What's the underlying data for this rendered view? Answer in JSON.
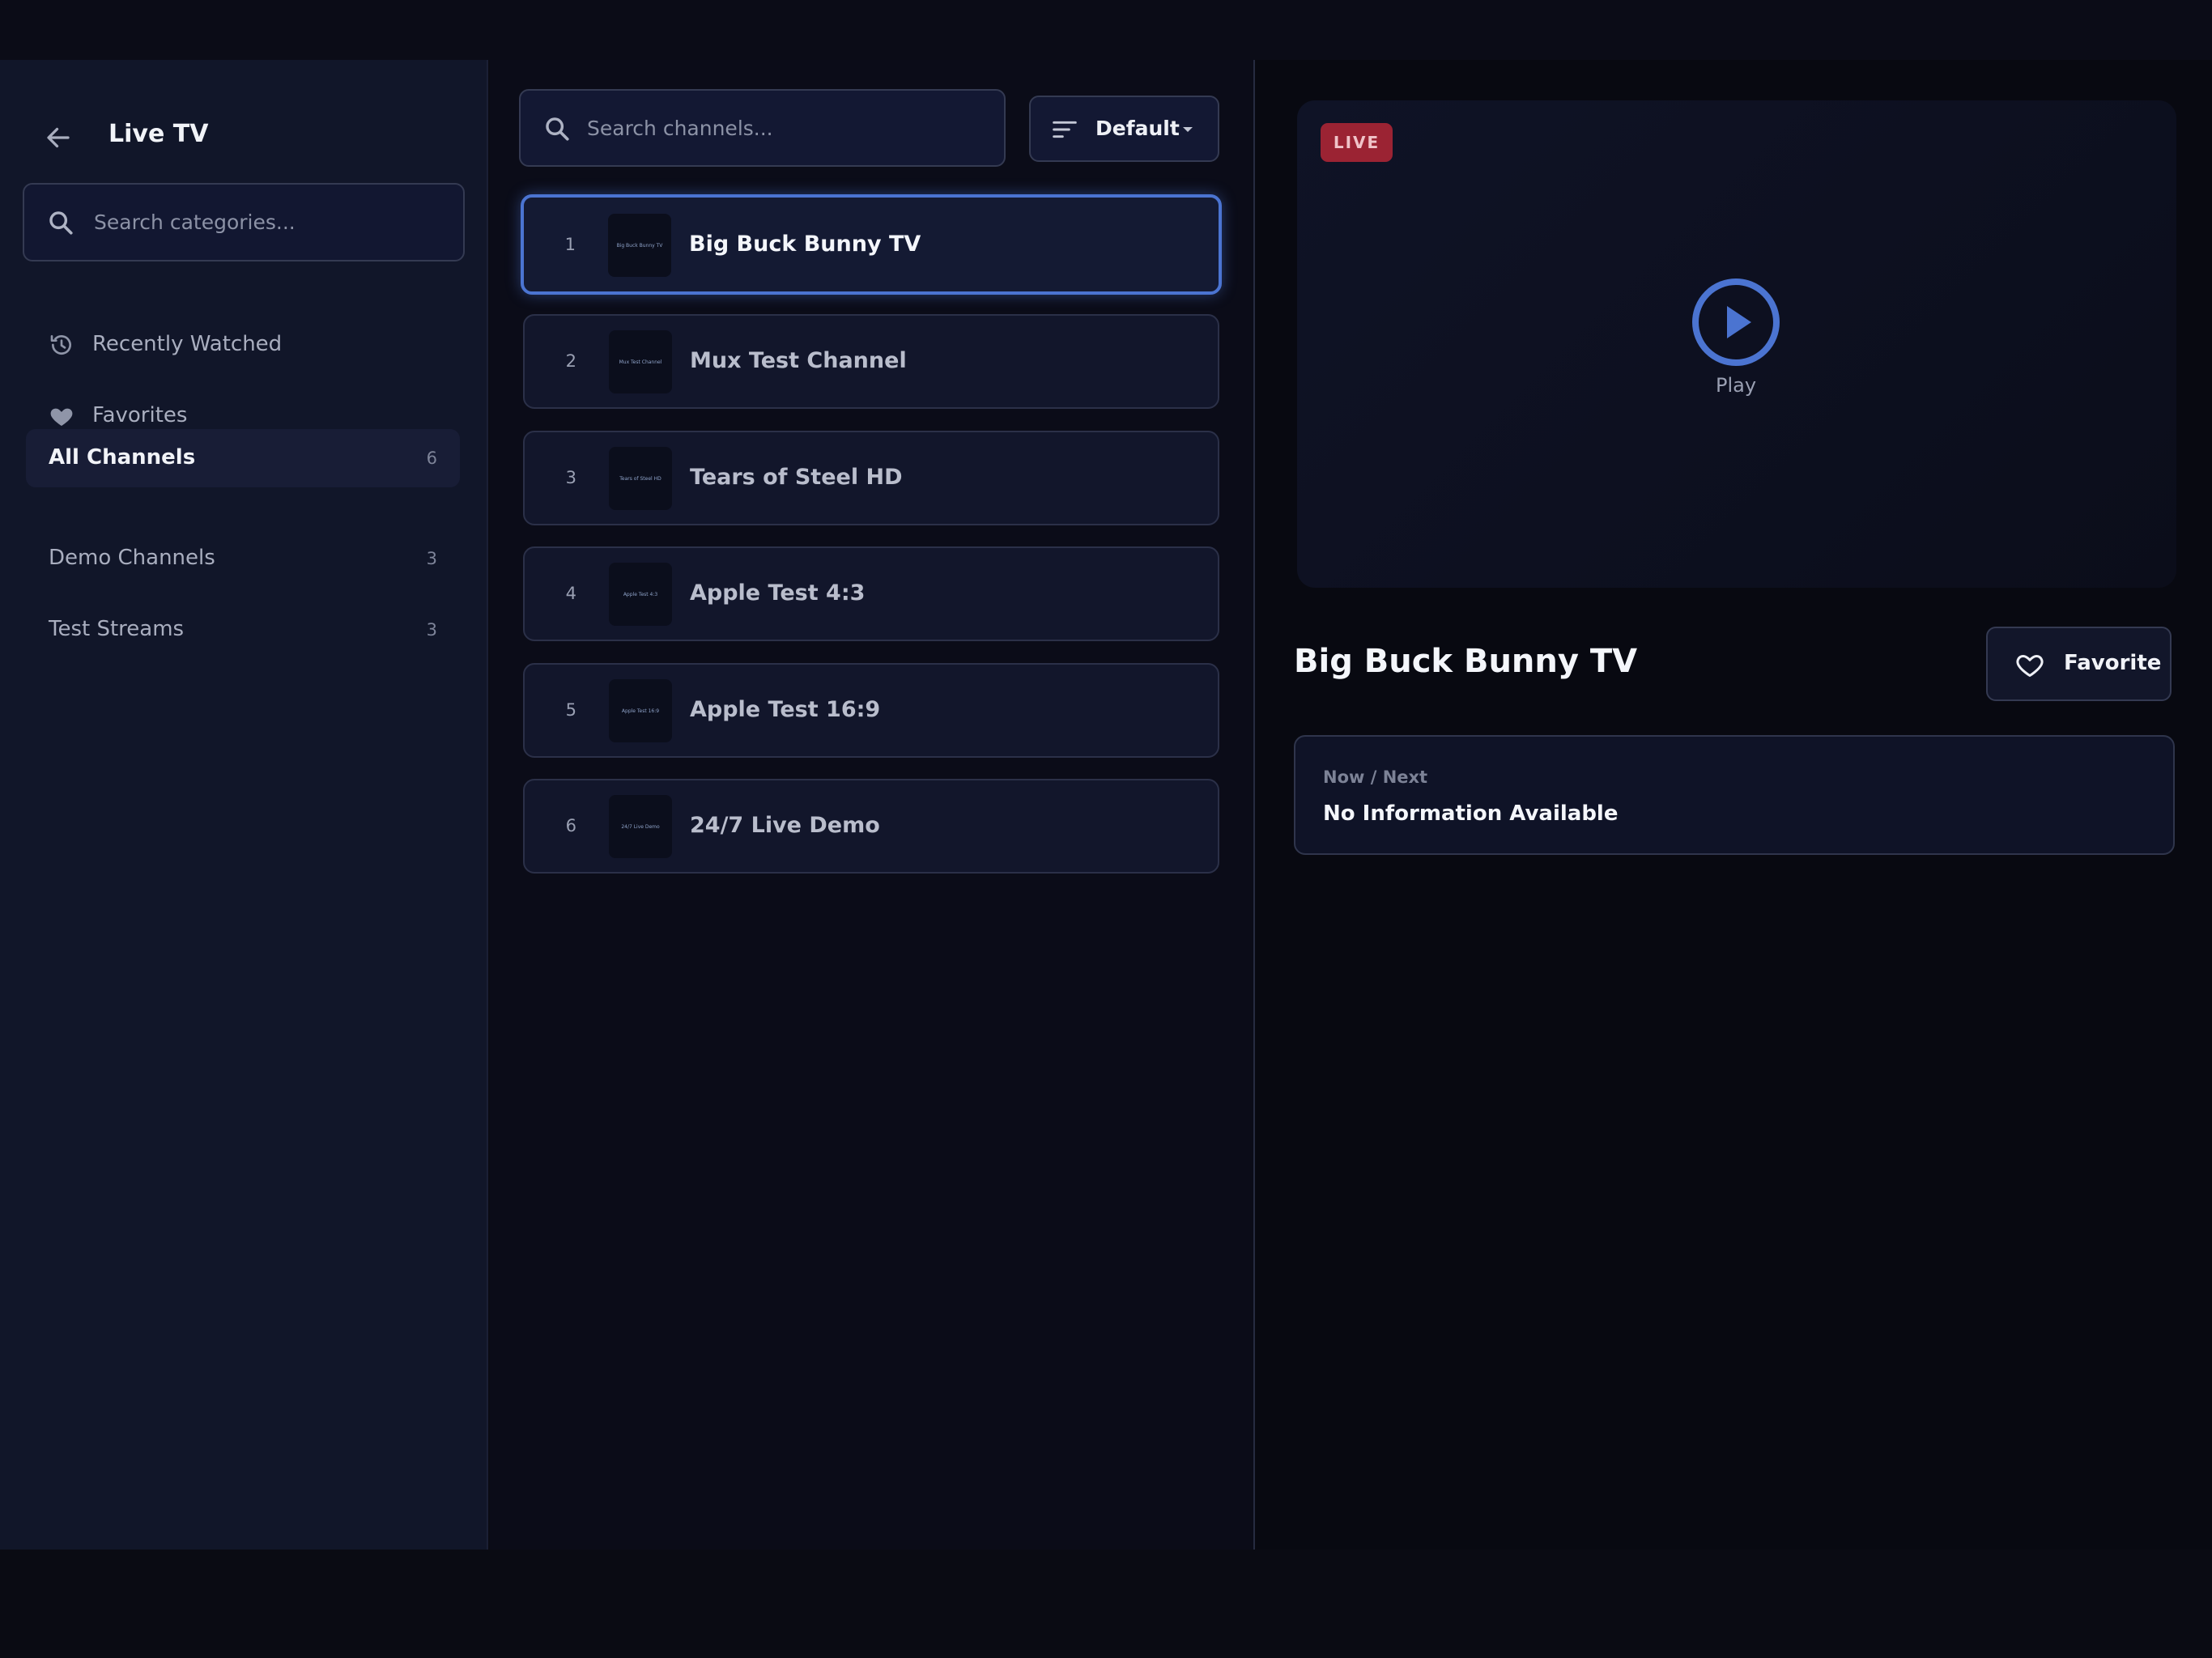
{
  "sidebar": {
    "title": "Live TV",
    "search_placeholder": "Search categories...",
    "items": [
      {
        "label": "Recently Watched",
        "icon": "history-icon"
      },
      {
        "label": "Favorites",
        "icon": "heart-icon"
      },
      {
        "label": "All Channels",
        "count": "6",
        "active": true
      },
      {
        "label": "Demo Channels",
        "count": "3"
      },
      {
        "label": "Test Streams",
        "count": "3"
      }
    ]
  },
  "channel_list": {
    "search_placeholder": "Search channels...",
    "sort_label": "Default",
    "channels": [
      {
        "number": "1",
        "name": "Big Buck Bunny TV",
        "logo_text": "Big Buck Bunny TV",
        "selected": true
      },
      {
        "number": "2",
        "name": "Mux Test Channel",
        "logo_text": "Mux Test Channel"
      },
      {
        "number": "3",
        "name": "Tears of Steel HD",
        "logo_text": "Tears of Steel HD"
      },
      {
        "number": "4",
        "name": "Apple Test 4:3",
        "logo_text": "Apple Test 4:3"
      },
      {
        "number": "5",
        "name": "Apple Test 16:9",
        "logo_text": "Apple Test 16:9"
      },
      {
        "number": "6",
        "name": "24/7 Live Demo",
        "logo_text": "24/7 Live Demo"
      }
    ]
  },
  "details": {
    "live_badge": "LIVE",
    "play_label": "Play",
    "channel_title": "Big Buck Bunny TV",
    "favorite_label": "Favorite",
    "epg_label": "Now / Next",
    "epg_value": "No Information Available"
  },
  "colors": {
    "accent": "#4b74d1",
    "live_badge": "#9b2333",
    "sidebar_bg": "#111629",
    "page_bg": "#0a0b14"
  }
}
